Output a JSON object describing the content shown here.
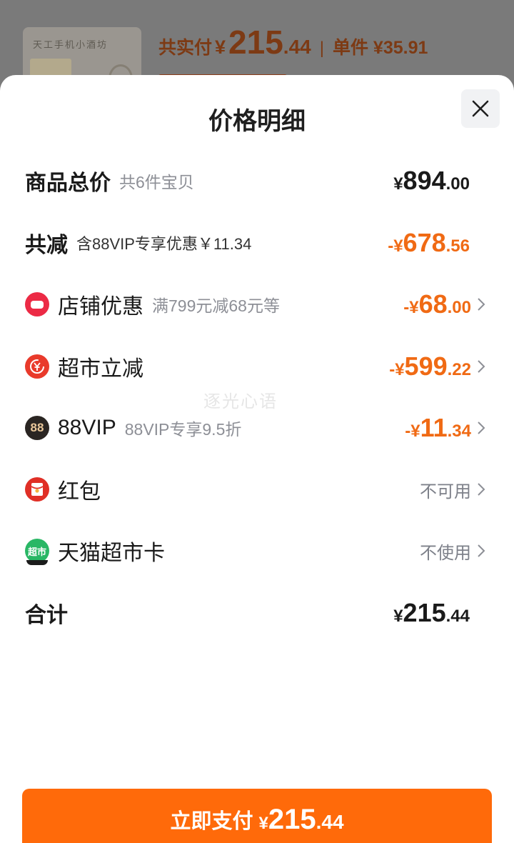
{
  "background": {
    "product_thumb_text": "天工手机小酒坊",
    "paid_label": "共实付",
    "paid_currency": "¥",
    "paid_int": "215",
    "paid_dec": ".44",
    "separator": "|",
    "unit_label": "单件 ¥35.91"
  },
  "sheet": {
    "title": "价格明细",
    "close_icon": "close-icon"
  },
  "rows": {
    "total": {
      "label": "商品总价",
      "sub": "共6件宝贝",
      "currency": "¥",
      "int": "894",
      "dec": ".00"
    },
    "discount": {
      "label": "共减",
      "sub": "含88VIP专享优惠￥11.34",
      "currency": "-¥",
      "int": "678",
      "dec": ".56"
    },
    "shop": {
      "icon": "shop-coupon-icon",
      "label": "店铺优惠",
      "sub": "满799元减68元等",
      "currency": "-¥",
      "int": "68",
      "dec": ".00"
    },
    "supermarket": {
      "icon": "yuan-cut-icon",
      "label": "超市立减",
      "currency": "-¥",
      "int": "599",
      "dec": ".22"
    },
    "vip": {
      "icon": "88vip-icon",
      "icon_text": "88",
      "label": "88VIP",
      "sub": "88VIP专享9.5折",
      "currency": "-¥",
      "int": "11",
      "dec": ".34"
    },
    "redpacket": {
      "icon": "red-packet-icon",
      "label": "红包",
      "status": "不可用"
    },
    "card": {
      "icon": "tmall-supermarket-card-icon",
      "icon_text": "超市",
      "label": "天猫超市卡",
      "status": "不使用"
    },
    "sum": {
      "label": "合计",
      "currency": "¥",
      "int": "215",
      "dec": ".44"
    }
  },
  "watermark": "逐光心语",
  "pay_button": {
    "label": "立即支付",
    "currency": "¥",
    "int": "215",
    "dec": ".44"
  },
  "colors": {
    "accent": "#ff6a0a",
    "discount": "#f06a14",
    "text": "#1a1a1a",
    "muted": "#8d8f96"
  }
}
